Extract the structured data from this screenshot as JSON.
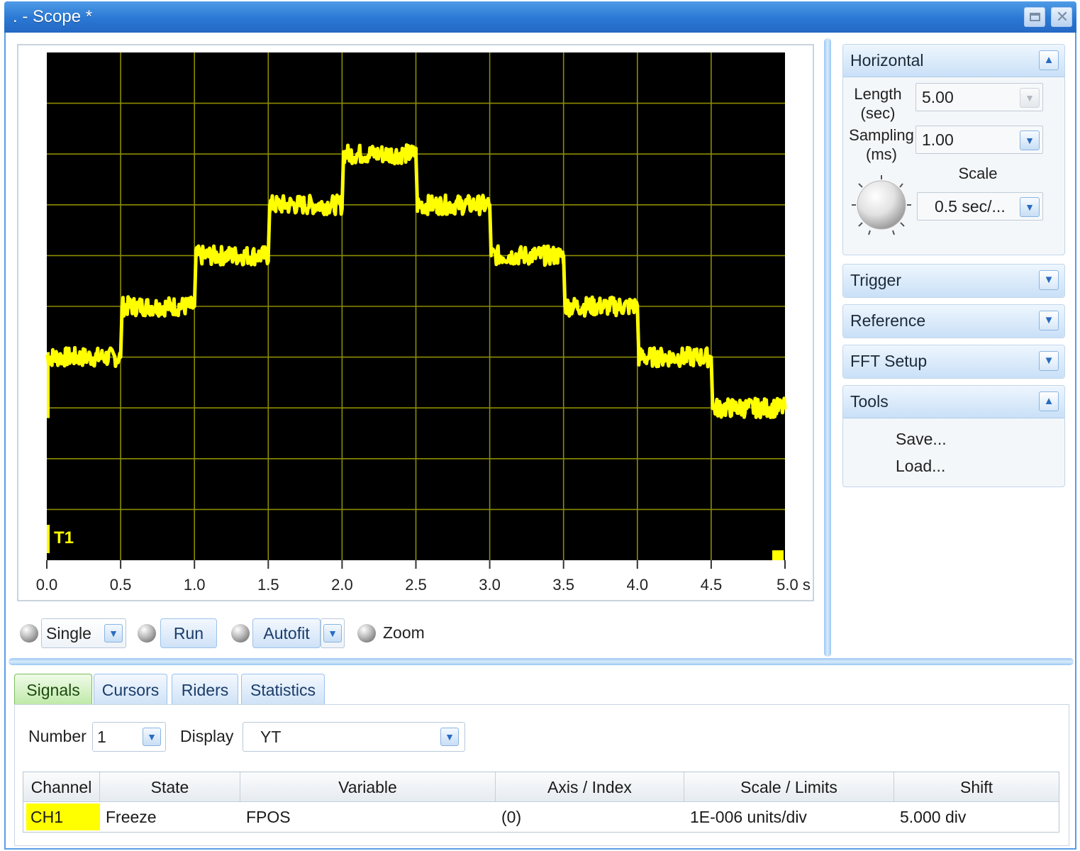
{
  "window": {
    "title": ". - Scope *"
  },
  "scope": {
    "x_ticks": [
      "0.0",
      "0.5",
      "1.0",
      "1.5",
      "2.0",
      "2.5",
      "3.0",
      "3.5",
      "4.0",
      "4.5",
      "5.0 s"
    ],
    "trace_label": "T1",
    "colors": {
      "background": "#000000",
      "grid": "#8c8c00",
      "trace": "#ffff00"
    }
  },
  "chart_data": {
    "type": "line",
    "xlim": [
      0,
      5
    ],
    "x": [
      0.0,
      0.5,
      0.51,
      1.0,
      1.01,
      1.5,
      1.51,
      2.0,
      2.01,
      2.5,
      2.51,
      3.0,
      3.01,
      3.5,
      3.51,
      4.0,
      4.01,
      4.5,
      4.51,
      5.0
    ],
    "y": [
      1.7,
      1.7,
      2.7,
      2.7,
      3.7,
      3.7,
      4.7,
      4.7,
      5.7,
      5.7,
      4.7,
      4.7,
      3.7,
      3.7,
      2.7,
      2.7,
      1.7,
      1.7,
      0.7,
      0.7
    ],
    "ylim": [
      -2.3,
      7.7
    ],
    "grid": true,
    "series": [
      {
        "name": "T1",
        "color": "#ffff00"
      }
    ]
  },
  "controls": {
    "single": "Single",
    "run": "Run",
    "autofit": "Autofit",
    "zoom": "Zoom"
  },
  "horizontal": {
    "title": "Horizontal",
    "length_label_1": "Length",
    "length_label_2": "(sec)",
    "length_value": "5.00",
    "sampling_label_1": "Sampling",
    "sampling_label_2": "(ms)",
    "sampling_value": "1.00",
    "scale_label": "Scale",
    "scale_value": "0.5 sec/..."
  },
  "panels": {
    "trigger": "Trigger",
    "reference": "Reference",
    "fft": "FFT Setup",
    "tools": "Tools",
    "save": "Save...",
    "load": "Load..."
  },
  "tabs": [
    "Signals",
    "Cursors",
    "Riders",
    "Statistics"
  ],
  "signals": {
    "number_label": "Number",
    "number_value": "1",
    "display_label": "Display",
    "display_value": "YT"
  },
  "table": {
    "columns": [
      "Channel",
      "State",
      "Variable",
      "Axis / Index",
      "Scale / Limits",
      "Shift"
    ],
    "rows": [
      {
        "channel": "CH1",
        "state": "Freeze",
        "variable": "FPOS",
        "axis": "(0)",
        "scale": "1E-006 units/div",
        "shift": "5.000 div"
      }
    ]
  }
}
